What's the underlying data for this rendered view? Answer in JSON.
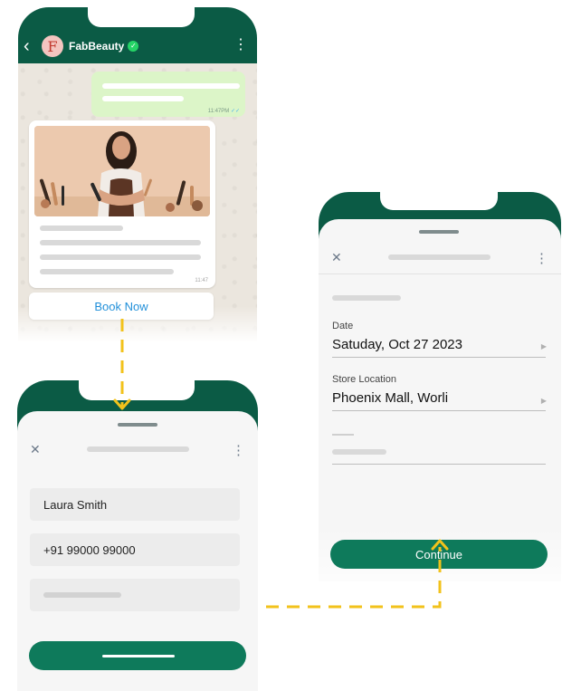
{
  "chat": {
    "brand_name": "FabBeauty",
    "avatar_letter": "F",
    "outgoing_time": "11:47PM",
    "card_time": "11:47",
    "book_button": "Book Now"
  },
  "form": {
    "name_value": "Laura Smith",
    "phone_value": "+91 99000 99000"
  },
  "booking": {
    "date_label": "Date",
    "date_value": "Satuday, Oct 27 2023",
    "location_label": "Store Location",
    "location_value": "Phoenix Mall, Worli",
    "continue_button": "Continue"
  },
  "colors": {
    "brand_green": "#0b5b45",
    "button_green": "#0e7a5b",
    "connector_yellow": "#f2c21b",
    "link_blue": "#1a8cd8"
  },
  "icons": [
    "back-arrow-icon",
    "verified-badge-icon",
    "kebab-menu-icon",
    "close-icon",
    "chevron-right-icon",
    "arrow-down-icon",
    "arrow-up-icon"
  ]
}
